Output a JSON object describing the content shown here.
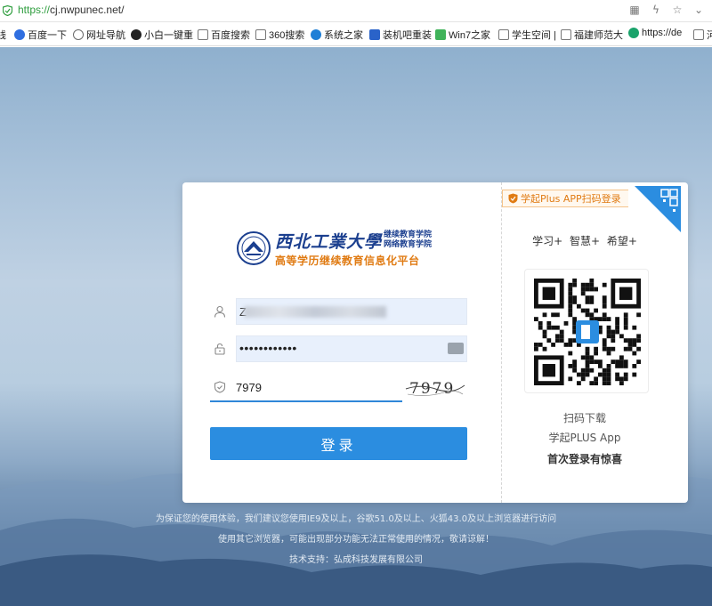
{
  "browser": {
    "url_scheme": "https://",
    "url_rest": "cj.nwpunec.net/",
    "bookmarks": [
      {
        "label": "线",
        "color": "#ffffff"
      },
      {
        "label": "百度一下",
        "color": "#2f6ee0"
      },
      {
        "label": "网址导航",
        "color": "#6b6b6b"
      },
      {
        "label": "小白一键重",
        "color": "#222222"
      },
      {
        "label": "百度搜索",
        "color": "#777777"
      },
      {
        "label": "360搜索",
        "color": "#777777"
      },
      {
        "label": "系统之家",
        "color": "#1f7fd6"
      },
      {
        "label": "装机吧重装",
        "color": "#2a63c9"
      },
      {
        "label": "Win7之家",
        "color": "#40b35a"
      },
      {
        "label": "学生空间 |",
        "color": "#777777"
      },
      {
        "label": "福建师范大",
        "color": "#777777"
      },
      {
        "label": "https://de",
        "color": "#1aa36b"
      },
      {
        "label": "河",
        "color": "#777777"
      }
    ]
  },
  "logo": {
    "name": "西北工業大學",
    "sub1": "继续教育学院",
    "sub2": "网络教育学院",
    "platform": "高等学历继续教育信息化平台"
  },
  "form": {
    "username_value": "Z",
    "password_value": "••••••••••••",
    "captcha_input": "7979",
    "captcha_image_text": "7979",
    "login_label": "登录"
  },
  "app": {
    "tag": "学起Plus APP扫码登录",
    "slogan": "学习+ 智慧+ 希望+",
    "scan_text": "扫码下载",
    "app_name": "学起PLUS App",
    "first_login": "首次登录有惊喜"
  },
  "footer": {
    "line1": "为保证您的使用体验，我们建议您使用IE9及以上，谷歌51.0及以上、火狐43.0及以上浏览器进行访问",
    "line2": "使用其它浏览器，可能出现部分功能无法正常使用的情况，敬请谅解！",
    "line3": "技术支持：弘成科技发展有限公司"
  }
}
